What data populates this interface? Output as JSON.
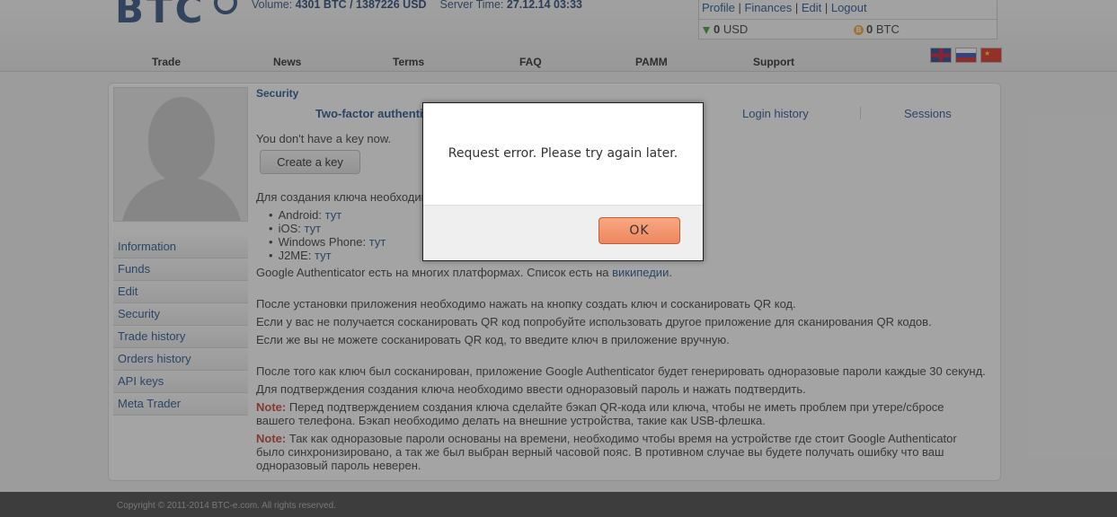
{
  "header": {
    "logo_text": "BTC",
    "volume_label": "Volume:",
    "volume_value": "4301 BTC / 1387226 USD",
    "server_time_label": "Server Time:",
    "server_time_value": "27.12.14 03:33",
    "user_links": [
      "Profile",
      "Finances",
      "Edit",
      "Logout"
    ],
    "balance_usd_amount": "0",
    "balance_usd_unit": "USD",
    "balance_btc_amount": "0",
    "balance_btc_unit": "BTC",
    "balance_btc_icon": "bitcoin-icon",
    "balance_usd_icon": "green-arrow-down-icon"
  },
  "nav": {
    "items": [
      "Trade",
      "News",
      "Terms",
      "FAQ",
      "PAMM",
      "Support"
    ]
  },
  "flags": [
    "flag-uk-icon",
    "flag-ru-icon",
    "flag-cn-icon"
  ],
  "sidebar": {
    "items": [
      "Information",
      "Funds",
      "Edit",
      "Security",
      "Trade history",
      "Orders history",
      "API keys",
      "Meta Trader"
    ]
  },
  "security": {
    "title": "Security",
    "tabs": [
      "Two-factor authenti",
      "Login history",
      "Sessions"
    ],
    "no_key_text": "You don't have a key now.",
    "create_key_label": "Create a key",
    "intro": "Для создания ключа необходимо",
    "apps": [
      {
        "platform": "Android:",
        "link": "тут"
      },
      {
        "platform": "iOS:",
        "link": "тут"
      },
      {
        "platform": "Windows Phone:",
        "link": "тут"
      },
      {
        "platform": "J2ME:",
        "link": "тут"
      }
    ],
    "google_text": "Google Authenticator есть на многих платформах. Список есть на",
    "google_link": "википедии",
    "google_end": ".",
    "para1": "После установки приложения необходимо нажать на кнопку создать ключ и сосканировать QR код.",
    "para2": "Если у вас не получается сосканировать QR код попробуйте использовать другое приложение для сканирования QR кодов.",
    "para3": "Если же вы не можете сосканировать QR код, то введите ключ в приложение вручную.",
    "para4": "После того как ключ был сосканирован, приложение Google Authenticator будет генерировать одноразовые пароли каждые 30 секунд.",
    "para5": "Для подтверждения создания ключа необходимо ввести одноразовый пароль и нажать подтвердить.",
    "note_label": "Note:",
    "note1": "Перед подтверждением создания ключа сделайте бэкап QR-кода или ключа, чтобы не иметь проблем при утере/сбросе вашего телефона. Бэкап необходимо делать на внешние устройства, такие как USB-флешка.",
    "note2": "Так как одноразовые пароли основаны на времени, необходимо чтобы время на устройстве где стоит Google Authenticator было синхронизировано, а так же был выбран верный часовой пояс. В противном случае вы будете получать ошибку что ваш одноразовый пароль неверен."
  },
  "footer": {
    "copyright": "Copyright © 2011-2014 BTC-e.com. All rights reserved."
  },
  "dialog": {
    "message": "Request error. Please try again later.",
    "ok_label": "OK"
  }
}
